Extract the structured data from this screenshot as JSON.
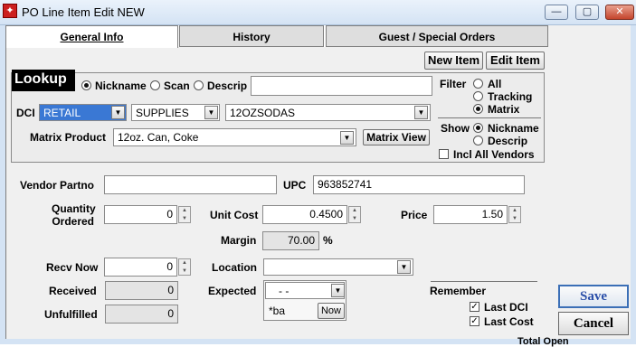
{
  "window": {
    "title": "PO Line Item Edit NEW",
    "app_icon": "app-logo-icon",
    "minimize_glyph": "—",
    "maximize_glyph": "▢",
    "close_glyph": "✕"
  },
  "tabs": [
    {
      "label": "General Info",
      "active": true
    },
    {
      "label": "History",
      "active": false
    },
    {
      "label": "Guest / Special Orders",
      "active": false
    }
  ],
  "buttons": {
    "new_item": "New Item",
    "edit_item": "Edit Item",
    "matrix_view": "Matrix View",
    "now": "Now",
    "save": "Save",
    "cancel": "Cancel"
  },
  "lookup": {
    "title": "Lookup",
    "search_modes": [
      {
        "label": "Nickname",
        "selected": true
      },
      {
        "label": "Scan",
        "selected": false
      },
      {
        "label": "Descrip",
        "selected": false
      }
    ],
    "search_value": "",
    "dci_label": "DCI",
    "dci_department": "RETAIL",
    "dci_class": "SUPPLIES",
    "dci_item": "12OZSODAS",
    "matrix_product_label": "Matrix Product",
    "matrix_product": "12oz. Can, Coke",
    "filter_label": "Filter",
    "filter_options": [
      {
        "label": "All",
        "selected": false
      },
      {
        "label": "Tracking",
        "selected": false
      },
      {
        "label": "Matrix",
        "selected": true
      }
    ],
    "show_label": "Show",
    "show_options": [
      {
        "label": "Nickname",
        "selected": true
      },
      {
        "label": "Descrip",
        "selected": false
      }
    ],
    "incl_all_vendors": {
      "label": "Incl All Vendors",
      "checked": false
    }
  },
  "fields": {
    "vendor_partno_label": "Vendor Partno",
    "vendor_partno": "",
    "upc_label": "UPC",
    "upc": "963852741",
    "quantity_ordered_label_1": "Quantity",
    "quantity_ordered_label_2": "Ordered",
    "quantity_ordered": "0",
    "unit_cost_label": "Unit Cost",
    "unit_cost": "0.4500",
    "price_label": "Price",
    "price": "1.50",
    "margin_label": "Margin",
    "margin": "70.00",
    "margin_unit": "%",
    "recv_now_label": "Recv Now",
    "recv_now": "0",
    "location_label": "Location",
    "location": "",
    "received_label": "Received",
    "received": "0",
    "expected_label": "Expected",
    "expected": "- -",
    "expected_note": "*ba",
    "unfulfilled_label": "Unfulfilled",
    "unfulfilled": "0"
  },
  "remember": {
    "title": "Remember",
    "last_dci": {
      "label": "Last DCI",
      "checked": true
    },
    "last_cost": {
      "label": "Last Cost",
      "checked": true
    }
  },
  "footer": {
    "total_open_label": "Total Open"
  },
  "colors": {
    "accent": "#3b6fb6",
    "dci_selected_bg": "#3a78d4",
    "lookup_label_bg": "#000000"
  }
}
